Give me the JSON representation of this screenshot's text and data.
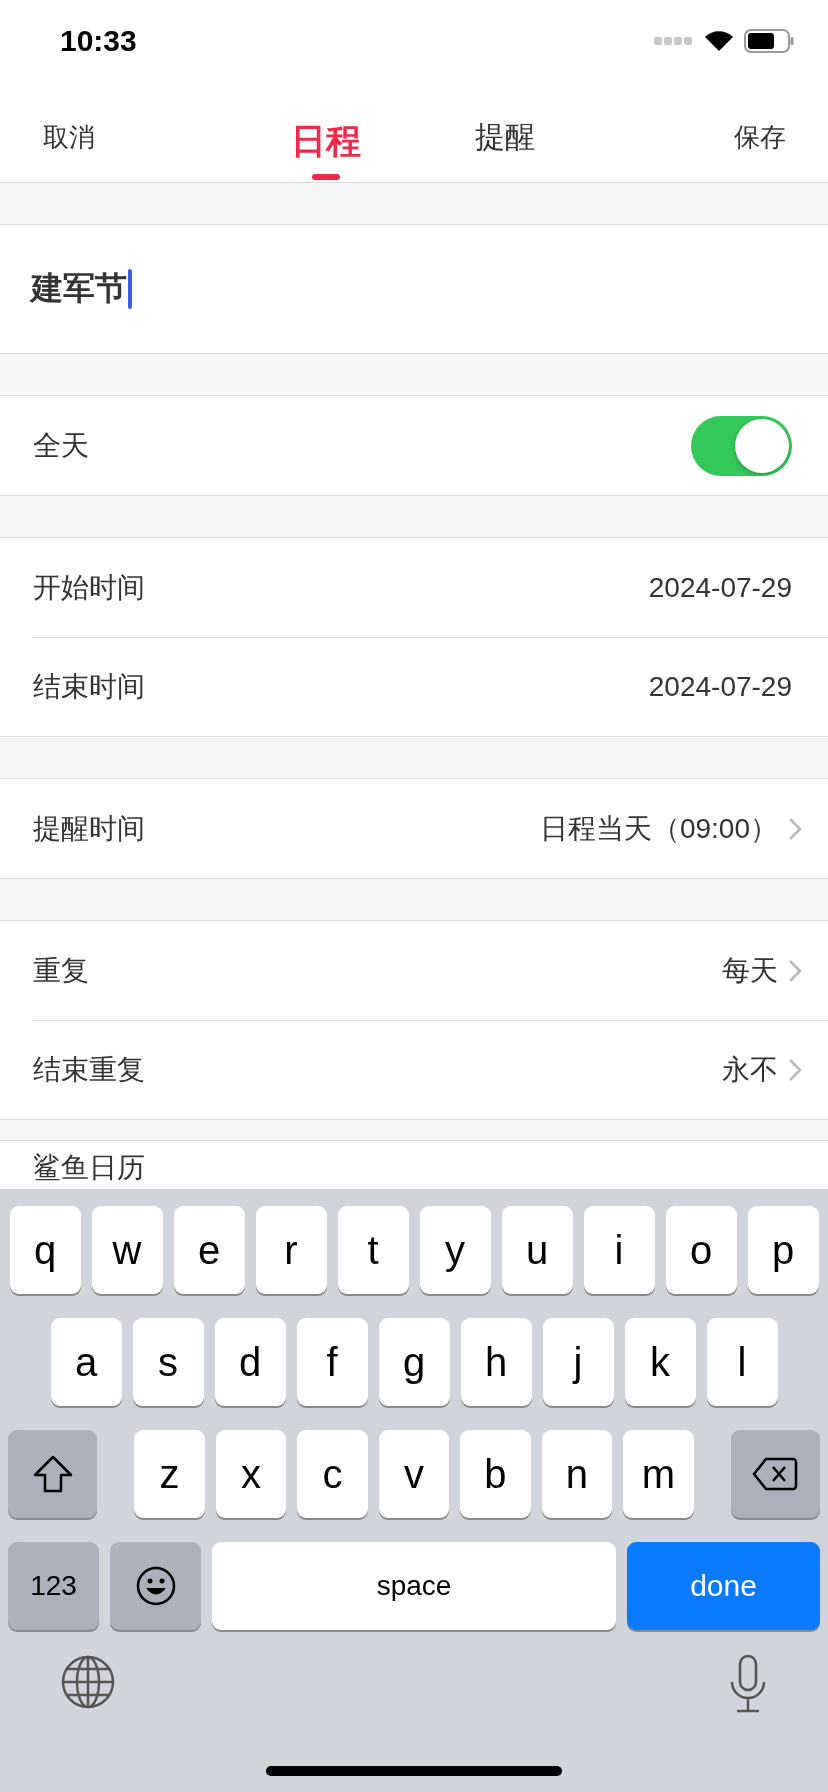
{
  "status_bar": {
    "time": "10:33"
  },
  "nav": {
    "cancel": "取消",
    "tabs": [
      {
        "label": "日程",
        "selected": true
      },
      {
        "label": "提醒",
        "selected": false
      }
    ],
    "save": "保存"
  },
  "title_field": {
    "value": "建军节"
  },
  "sections": [
    {
      "rows": [
        {
          "kind": "toggle",
          "label": "全天",
          "on": true
        }
      ]
    },
    {
      "rows": [
        {
          "kind": "value",
          "label": "开始时间",
          "value": "2024-07-29"
        },
        {
          "kind": "value",
          "label": "结束时间",
          "value": "2024-07-29"
        }
      ]
    },
    {
      "rows": [
        {
          "kind": "link",
          "label": "提醒时间",
          "value": "日程当天（09:00）"
        }
      ]
    },
    {
      "rows": [
        {
          "kind": "link",
          "label": "重复",
          "value": "每天"
        },
        {
          "kind": "link",
          "label": "结束重复",
          "value": "永不"
        }
      ]
    },
    {
      "rows": [
        {
          "kind": "plain",
          "label": "鲨鱼日历"
        }
      ]
    }
  ],
  "keyboard": {
    "key_rows": [
      {
        "keys": [
          {
            "kind": "letter",
            "label": "q"
          },
          {
            "kind": "letter",
            "label": "w"
          },
          {
            "kind": "letter",
            "label": "e"
          },
          {
            "kind": "letter",
            "label": "r"
          },
          {
            "kind": "letter",
            "label": "t"
          },
          {
            "kind": "letter",
            "label": "y"
          },
          {
            "kind": "letter",
            "label": "u"
          },
          {
            "kind": "letter",
            "label": "i"
          },
          {
            "kind": "letter",
            "label": "o"
          },
          {
            "kind": "letter",
            "label": "p"
          }
        ]
      },
      {
        "keys": [
          {
            "kind": "letter",
            "label": "a"
          },
          {
            "kind": "letter",
            "label": "s"
          },
          {
            "kind": "letter",
            "label": "d"
          },
          {
            "kind": "letter",
            "label": "f"
          },
          {
            "kind": "letter",
            "label": "g"
          },
          {
            "kind": "letter",
            "label": "h"
          },
          {
            "kind": "letter",
            "label": "j"
          },
          {
            "kind": "letter",
            "label": "k"
          },
          {
            "kind": "letter",
            "label": "l"
          }
        ]
      },
      {
        "keys": [
          {
            "kind": "shift"
          },
          {
            "kind": "letter",
            "label": "z"
          },
          {
            "kind": "letter",
            "label": "x"
          },
          {
            "kind": "letter",
            "label": "c"
          },
          {
            "kind": "letter",
            "label": "v"
          },
          {
            "kind": "letter",
            "label": "b"
          },
          {
            "kind": "letter",
            "label": "n"
          },
          {
            "kind": "letter",
            "label": "m"
          },
          {
            "kind": "backspace"
          }
        ]
      },
      {
        "keys": [
          {
            "kind": "numbers",
            "label": "123"
          },
          {
            "kind": "emoji"
          },
          {
            "kind": "space",
            "label": "space"
          },
          {
            "kind": "done",
            "label": "done"
          }
        ]
      }
    ]
  }
}
